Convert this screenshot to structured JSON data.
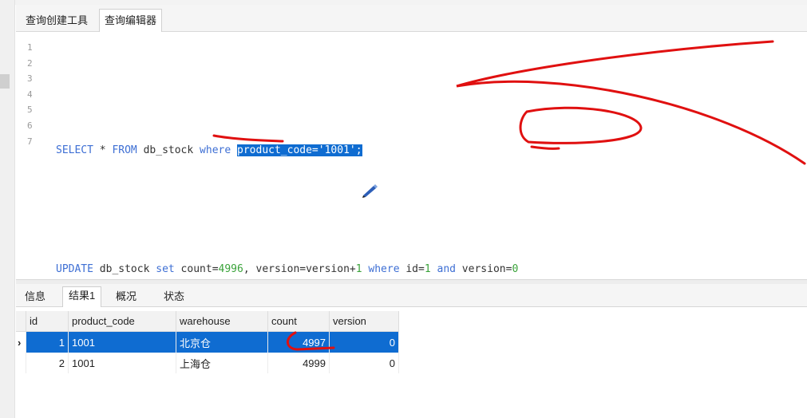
{
  "query_tabs": [
    "查询创建工具",
    "查询编辑器"
  ],
  "editor": {
    "line_numbers": [
      "1",
      "2",
      "3",
      "4",
      "5",
      "6",
      "7"
    ],
    "line3": {
      "kw_select": "SELECT",
      "rest_a": " * ",
      "kw_from": "FROM",
      "table": " db_stock ",
      "kw_where": "where",
      "space": " ",
      "selected": "product_code='1001';"
    },
    "line6": {
      "kw_update": "UPDATE",
      "table": " db_stock ",
      "kw_set": "set",
      "p1": " count=",
      "count_val": "4996",
      "p2": ", version=version+",
      "inc_val": "1",
      "p3": " ",
      "kw_where": "where",
      "p4": " id=",
      "id_val": "1",
      "p5": " ",
      "kw_and": "and",
      "p6": " version=",
      "ver_val": "0"
    }
  },
  "result_tabs": [
    "信息",
    "结果1",
    "概况",
    "状态"
  ],
  "grid": {
    "columns": [
      "id",
      "product_code",
      "warehouse",
      "count",
      "version"
    ],
    "rows": [
      {
        "marker": "›",
        "id": "1",
        "product_code": "1001",
        "warehouse": "北京仓",
        "count": "4997",
        "version": "0"
      },
      {
        "marker": "",
        "id": "2",
        "product_code": "1001",
        "warehouse": "上海仓",
        "count": "4999",
        "version": "0"
      }
    ]
  },
  "colors": {
    "selection": "#0f6cd1",
    "keyword": "#3e6fd4",
    "number": "#3aa33a",
    "annotation": "#e01010"
  }
}
